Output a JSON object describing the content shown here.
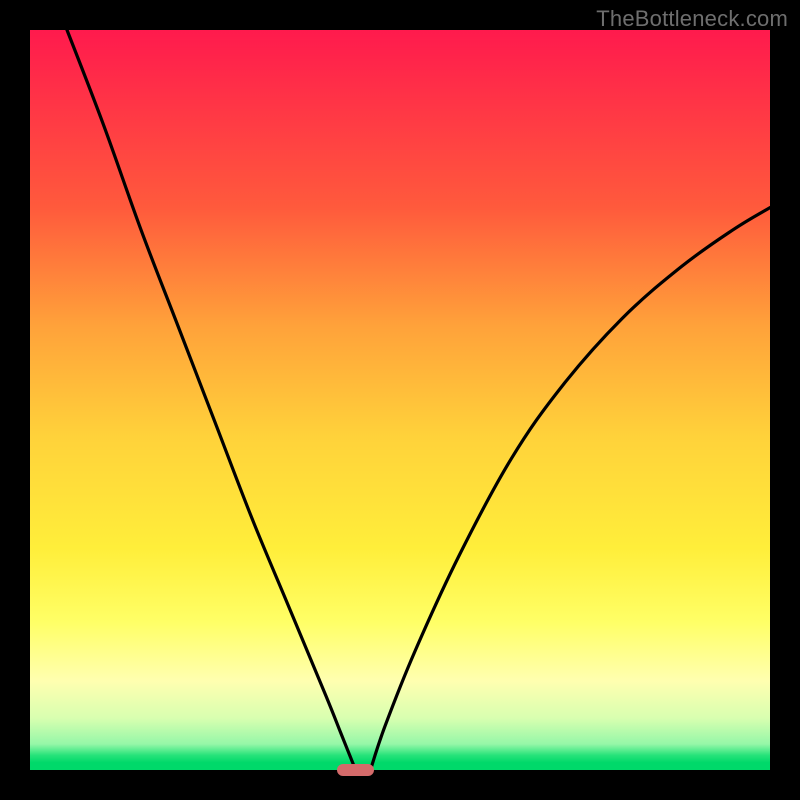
{
  "watermark": "TheBottleneck.com",
  "colors": {
    "frame": "#000000",
    "gradient_top": "#ff1a4d",
    "gradient_bottom": "#00d96a",
    "curve": "#000000",
    "marker": "#d46a6a"
  },
  "chart_data": {
    "type": "line",
    "title": "",
    "xlabel": "",
    "ylabel": "",
    "xlim": [
      0,
      100
    ],
    "ylim": [
      0,
      100
    ],
    "grid": false,
    "legend": false,
    "notes": "Bottleneck-style V-curve. Two monotone curves descend to a common minimum near x≈44, y≈0; background is a vertical red→green gradient; a small rounded marker sits at the minimum on the x-axis.",
    "series": [
      {
        "name": "left_curve",
        "x": [
          5,
          10,
          15,
          20,
          25,
          30,
          35,
          40,
          42,
          44
        ],
        "y": [
          100,
          87,
          73,
          60,
          47,
          34,
          22,
          10,
          5,
          0
        ]
      },
      {
        "name": "right_curve",
        "x": [
          46,
          48,
          52,
          58,
          65,
          72,
          80,
          88,
          95,
          100
        ],
        "y": [
          0,
          6,
          16,
          29,
          42,
          52,
          61,
          68,
          73,
          76
        ]
      }
    ],
    "marker": {
      "x_center": 44,
      "width_pct": 5,
      "y": 0
    }
  }
}
